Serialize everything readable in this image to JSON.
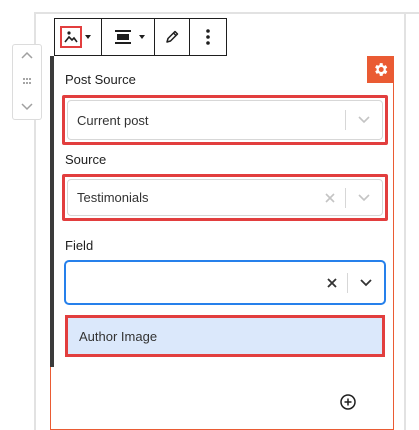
{
  "toolbar": {
    "image_tool": "image-icon",
    "align_tool": "align-center-icon",
    "edit_tool": "pencil-icon",
    "more_tool": "more-vertical-icon"
  },
  "block": {
    "settings_icon": "gear-icon",
    "accent_color": "#ea5b33",
    "highlight_color": "#e23e3e"
  },
  "post_source": {
    "label": "Post Source",
    "value": "Current post"
  },
  "source": {
    "label": "Source",
    "value": "Testimonials"
  },
  "field": {
    "label": "Field",
    "value": ""
  },
  "dropdown": {
    "options": [
      "Author Image"
    ]
  },
  "add_block": {
    "icon": "plus-circle-icon"
  }
}
